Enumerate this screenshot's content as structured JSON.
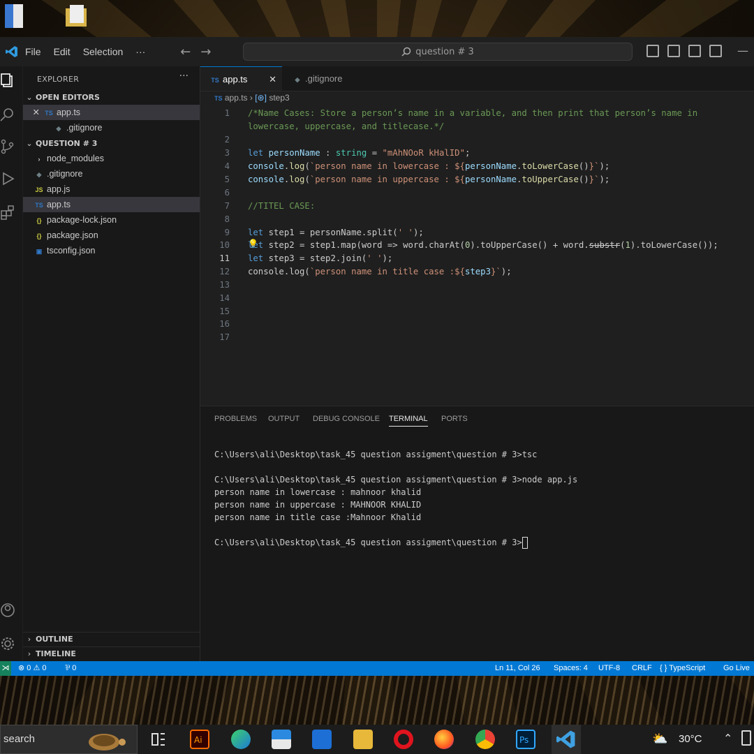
{
  "window": {
    "search_text": "question # 3"
  },
  "menu": [
    "File",
    "Edit",
    "Selection",
    "···"
  ],
  "explorer": {
    "title": "EXPLORER",
    "open_editors_label": "OPEN EDITORS",
    "open_editors": [
      {
        "name": "app.ts",
        "type": "ts",
        "close": "✕"
      },
      {
        "name": ".gitignore",
        "type": "git"
      }
    ],
    "project_label": "QUESTION # 3",
    "files": [
      {
        "name": "node_modules",
        "type": "folder"
      },
      {
        "name": ".gitignore",
        "type": "git"
      },
      {
        "name": "app.js",
        "type": "js"
      },
      {
        "name": "app.ts",
        "type": "ts"
      },
      {
        "name": "package-lock.json",
        "type": "json"
      },
      {
        "name": "package.json",
        "type": "json"
      },
      {
        "name": "tsconfig.json",
        "type": "tsconfig"
      }
    ],
    "outline_label": "OUTLINE",
    "timeline_label": "TIMELINE"
  },
  "tabs": [
    {
      "label": "app.ts",
      "close": "✕"
    },
    {
      "label": ".gitignore"
    }
  ],
  "breadcrumb": {
    "file": "app.ts",
    "symbol": "step3"
  },
  "code_lines": [
    "1",
    "2",
    "3",
    "4",
    "5",
    "6",
    "7",
    "8",
    "9",
    "10",
    "11",
    "12",
    "13",
    "14",
    "15",
    "16",
    "17"
  ],
  "code": {
    "l1": "/*Name Cases: Store a person’s name in a variable, and then print that person’s name in",
    "l1b": "lowercase, uppercase, and titlecase.*/",
    "l3_kw": "let",
    "l3_var": " personName",
    "l3_op": " : ",
    "l3_ty": "string",
    "l3_eq": " = ",
    "l3_str": "\"mAhNOoR kHalID\"",
    "l3_end": ";",
    "l4_a": "console",
    "l4_b": ".",
    "l4_fn": "log",
    "l4_c": "(",
    "l4_s": "`person name in lowercase : ${",
    "l4_v": "personName",
    "l4_d": ".",
    "l4_fn2": "toLowerCase",
    "l4_e": "()",
    "l4_s2": "}`",
    "l4_f": ");",
    "l5_a": "console",
    "l5_b": ".",
    "l5_fn": "log",
    "l5_c": "(",
    "l5_s": "`person name in uppercase : ${",
    "l5_v": "personName",
    "l5_d": ".",
    "l5_fn2": "toUpperCase",
    "l5_e": "()",
    "l5_s2": "}`",
    "l5_f": ");",
    "l7": "//TITEL CASE:",
    "l9_kw": "let",
    "l9_rest": " step1 = personName.split(",
    "l9_s": "' '",
    "l9_end": ");",
    "l10_kw": "let",
    "l10_rest": " step2 = step1.map(word => word.charAt(",
    "l10_n": "0",
    "l10_rest2": ").toUpperCase() + word.",
    "l10_strike": "substr",
    "l10_rest3": "(",
    "l10_n2": "1",
    "l10_rest4": ").toLowerCase());",
    "l11_kw": "let",
    "l11_rest": " step3 = step2.join(",
    "l11_s": "' '",
    "l11_end": ");",
    "l12_a": "console.log(",
    "l12_s": "`person name in title case :${",
    "l12_v": "step3",
    "l12_s2": "}`",
    "l12_end": ");"
  },
  "panel": {
    "tabs": [
      "PROBLEMS",
      "OUTPUT",
      "DEBUG CONSOLE",
      "TERMINAL",
      "PORTS"
    ],
    "terminal": [
      "C:\\Users\\ali\\Desktop\\task_45 question assigment\\question # 3>tsc",
      "",
      "C:\\Users\\ali\\Desktop\\task_45 question assigment\\question # 3>node app.js",
      "person name in lowercase : mahnoor khalid",
      "person name in uppercase : MAHNOOR KHALID",
      "person name in title case :Mahnoor Khalid",
      "",
      "C:\\Users\\ali\\Desktop\\task_45 question assigment\\question # 3>"
    ]
  },
  "status": {
    "errors": "⊗ 0 ⚠ 0",
    "ports": "⅌ 0",
    "position": "Ln 11, Col 26",
    "spaces": "Spaces: 4",
    "encoding": "UTF-8",
    "eol": "CRLF",
    "language": "{ } TypeScript",
    "golive": "Go Live"
  },
  "taskbar": {
    "search": "search",
    "weather": "30°C"
  },
  "colors": {
    "accent": "#0078d4",
    "ts": "#3178c6"
  }
}
